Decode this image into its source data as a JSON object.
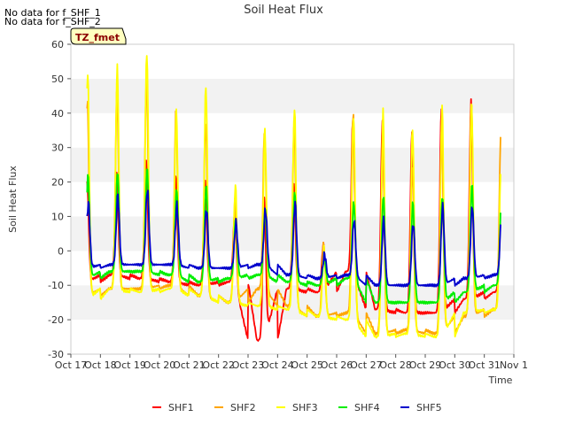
{
  "notes": [
    "No data for f_SHF_1",
    "No data for f_SHF_2"
  ],
  "site_badge": "TZ_fmet",
  "chart_data": {
    "type": "line",
    "title": "Soil Heat Flux",
    "xlabel": "Time",
    "ylabel": "Soil Heat Flux",
    "ylim": [
      -30,
      60
    ],
    "y_ticks": [
      -30,
      -20,
      -10,
      0,
      10,
      20,
      30,
      40,
      50,
      60
    ],
    "x_ticks": [
      "Oct 17",
      "Oct 18",
      "Oct 19",
      "Oct 20",
      "Oct 21",
      "Oct 22",
      "Oct 23",
      "Oct 24",
      "Oct 25",
      "Oct 26",
      "Oct 27",
      "Oct 28",
      "Oct 29",
      "Oct 30",
      "Oct 31",
      "Nov 1"
    ],
    "x_start": "2016-10-17",
    "x_end": "2016-11-01",
    "grid": "horizontal bands",
    "legend_position": "bottom",
    "daily": {
      "days": [
        "Oct 17",
        "Oct 18",
        "Oct 19",
        "Oct 20",
        "Oct 21",
        "Oct 22",
        "Oct 23",
        "Oct 24",
        "Oct 25",
        "Oct 26",
        "Oct 27",
        "Oct 28",
        "Oct 29",
        "Oct 30",
        "Oct 31"
      ],
      "note": "per-day peak and minimum, read from the plot"
    },
    "series": [
      {
        "name": "SHF1",
        "color": "#ff0000",
        "peaks": [
          20,
          23,
          26,
          22,
          20,
          11,
          15,
          20,
          2,
          38,
          38,
          34,
          42,
          43,
          8
        ],
        "mins": [
          -9,
          -7,
          -8,
          -9,
          -10,
          -9,
          -26,
          -11,
          -12,
          -6,
          -17,
          -18,
          -18,
          -14,
          -12
        ]
      },
      {
        "name": "SHF2",
        "color": "#ffa500",
        "peaks": [
          43,
          46,
          51,
          40,
          38,
          15,
          35,
          37,
          2,
          40,
          31,
          25,
          35,
          44,
          34
        ],
        "mins": [
          -13,
          -11,
          -11,
          -10,
          -13,
          -15,
          -11,
          -16,
          -19,
          -18,
          -24,
          -23,
          -24,
          -19,
          -17
        ]
      },
      {
        "name": "SHF3",
        "color": "#ffff00",
        "peaks": [
          52,
          53,
          58,
          40,
          48,
          19,
          35,
          42,
          0,
          40,
          40,
          36,
          42,
          42,
          26
        ],
        "mins": [
          -14,
          -11,
          -12,
          -11,
          -13,
          -15,
          -16,
          -17,
          -19,
          -20,
          -25,
          -24,
          -25,
          -18,
          -17
        ]
      },
      {
        "name": "SHF4",
        "color": "#00ee00",
        "peaks": [
          22,
          23,
          24,
          18,
          19,
          9,
          12,
          17,
          -2,
          14,
          16,
          14,
          16,
          19,
          14
        ],
        "mins": [
          -8,
          -6,
          -6,
          -7,
          -9,
          -8,
          -7,
          -9,
          -10,
          -8,
          -15,
          -15,
          -15,
          -12,
          -10
        ]
      },
      {
        "name": "SHF5",
        "color": "#0000cc",
        "peaks": [
          14,
          16,
          18,
          13,
          12,
          8,
          12,
          14,
          -1,
          9,
          9,
          8,
          13,
          13,
          12
        ],
        "mins": [
          -5,
          -4,
          -4,
          -4,
          -5,
          -5,
          -4,
          -7,
          -8,
          -7,
          -10,
          -10,
          -10,
          -8,
          -7
        ]
      }
    ]
  }
}
